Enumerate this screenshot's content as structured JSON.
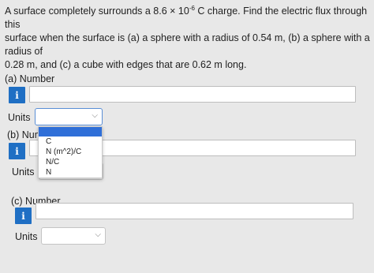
{
  "question": {
    "line1_pre": "A surface completely surrounds a 8.6 × 10",
    "exponent": "-6",
    "line1_post": " C charge. Find the electric flux through this",
    "line2": "surface when the surface is (a) a sphere with a radius of 0.54 m, (b) a sphere with a radius of",
    "line3": "0.28 m, and (c) a cube with edges that are 0.62 m long."
  },
  "parts": {
    "a": {
      "number_label": "(a) Number",
      "units_label": "Units",
      "number_value": "",
      "units_value": ""
    },
    "b": {
      "number_label": "(b) Number",
      "units_label": "Units",
      "number_value": "",
      "units_value": ""
    },
    "c": {
      "number_label": "(c) Number",
      "units_label": "Units",
      "number_value": "",
      "units_value": ""
    }
  },
  "info_icon": "i",
  "chevron": "⌵",
  "dropdown": {
    "options": [
      "C",
      "N (m^2)/C",
      "N/C",
      "N"
    ]
  }
}
